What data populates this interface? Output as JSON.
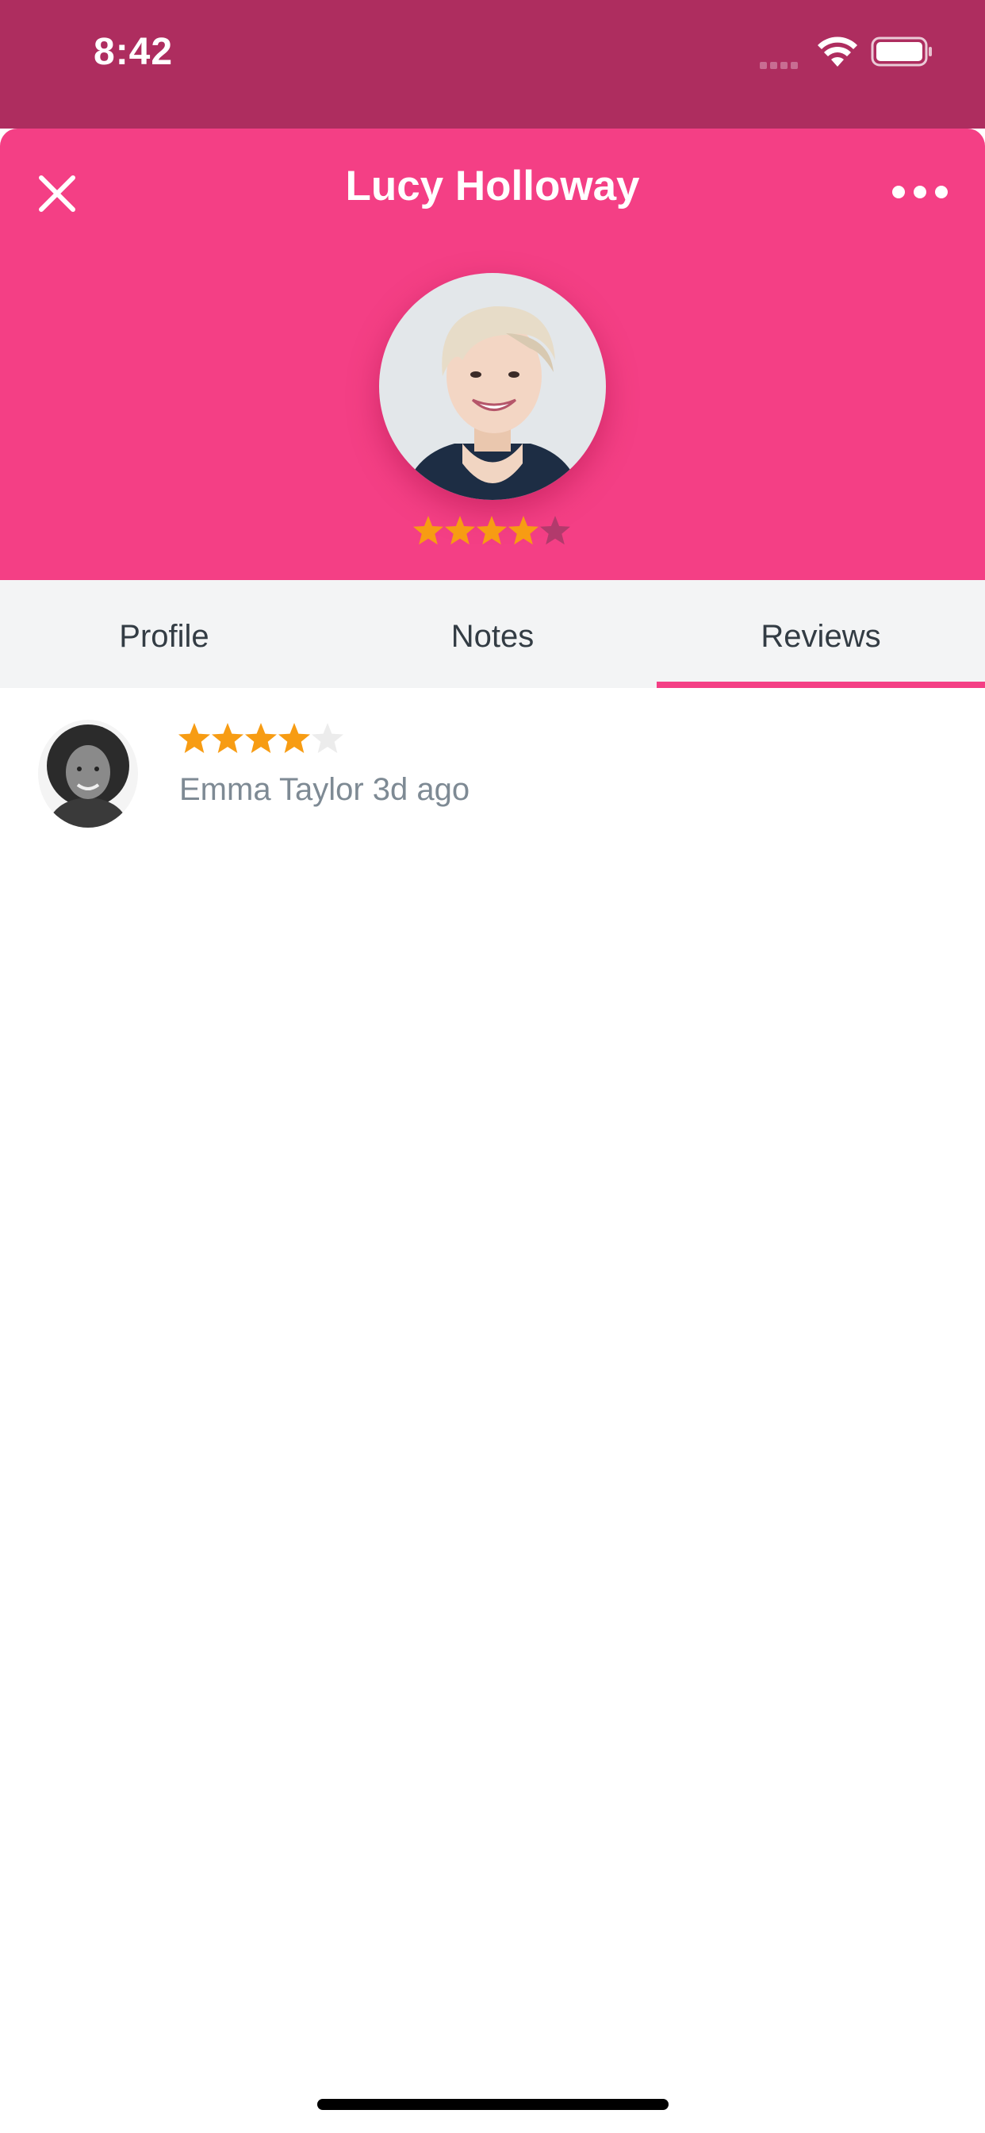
{
  "status_bar": {
    "time": "8:42"
  },
  "header": {
    "title": "Lucy Holloway",
    "rating": 4,
    "rating_max": 5
  },
  "tabs": [
    {
      "label": "Profile",
      "active": false
    },
    {
      "label": "Notes",
      "active": false
    },
    {
      "label": "Reviews",
      "active": true
    }
  ],
  "reviews": [
    {
      "reviewer": "Emma Taylor",
      "age": "3d ago",
      "rating": 4,
      "rating_max": 5
    }
  ],
  "colors": {
    "status_bar": "#ae2d5f",
    "header": "#f43f85",
    "star_filled": "#f79c13",
    "star_empty_header": "#b23a6c",
    "star_empty_review": "#ececec",
    "accent": "#f43f85"
  },
  "icons": [
    "close-icon",
    "more-icon",
    "wifi-icon",
    "battery-icon",
    "star-icon"
  ]
}
